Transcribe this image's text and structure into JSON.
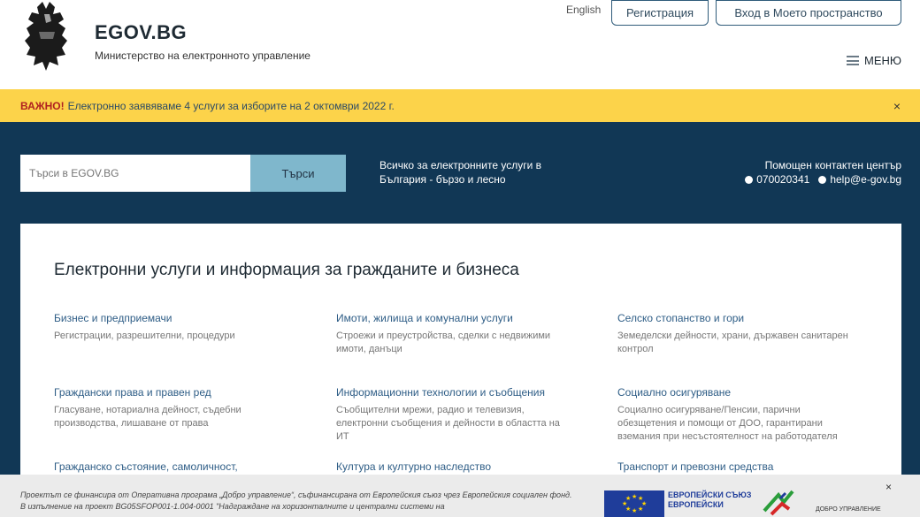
{
  "header": {
    "title": "EGOV.BG",
    "subtitle": "Министерство на електронното управление",
    "lang_link": "English",
    "register_label": "Регистрация",
    "login_label": "Вход в Моето пространство",
    "menu_label": "МЕНЮ"
  },
  "alert": {
    "strong": "ВАЖНО!",
    "text": "Електронно заявяваме 4 услуги за изборите на 2 октомври 2022 г.",
    "close": "×"
  },
  "hero": {
    "search_placeholder": "Търси в EGOV.BG",
    "search_button": "Търси",
    "tagline": "Всичко за електронните услуги в България - бързо и лесно",
    "contact_title": "Помощен контактен център",
    "phone": "070020341",
    "email": "help@e-gov.bg"
  },
  "services": {
    "heading": "Електронни услуги и информация за гражданите и бизнеса",
    "items": [
      {
        "title": "Бизнес и предприемачи",
        "desc": "Регистрации, разрешителни, процедури"
      },
      {
        "title": "Имоти, жилища и комунални услуги",
        "desc": "Строежи и преустройства, сделки с недвижими имоти, данъци"
      },
      {
        "title": "Селско стопанство и гори",
        "desc": "Земеделски дейности, храни, държавен санитарен контрол"
      },
      {
        "title": "Граждански права и правен ред",
        "desc": "Гласуване, нотариална дейност, съдебни производства, лишаване от права"
      },
      {
        "title": "Информационни технологии и съобщения",
        "desc": "Съобщителни мрежи, радио и телевизия, електронни съобщения и дейности в областта на ИТ"
      },
      {
        "title": "Социално осигуряване",
        "desc": "Социално осигуряване/Пенсии, парични обезщетения и помощи от ДОО, гарантирани вземания при несъстоятелност на работодателя"
      },
      {
        "title": "Гражданско състояние, самоличност,",
        "desc": ""
      },
      {
        "title": "Култура и културно наследство",
        "desc": ""
      },
      {
        "title": "Транспорт и превозни средства",
        "desc": ""
      }
    ]
  },
  "funding": {
    "text": "Проектът се финансира от Оперативна програма „Добро управление“, съфинансирана от Европейския съюз чрез Европейския социален фонд. В изпълнение на проект BG05SFOP001-1.004-0001 \"Надграждане на хоризонталните и централни системи на",
    "eu_line1": "ЕВРОПЕЙСКИ СЪЮЗ",
    "eu_line2": "ЕВРОПЕЙСКИ",
    "dobro_label": "ДОБРО УПРАВЛЕНИЕ",
    "close": "×"
  },
  "colors": {
    "hero_bg": "#113755",
    "alert_bg": "#fcd34a",
    "link": "#2e5d86",
    "search_btn": "#7fb7cc"
  }
}
